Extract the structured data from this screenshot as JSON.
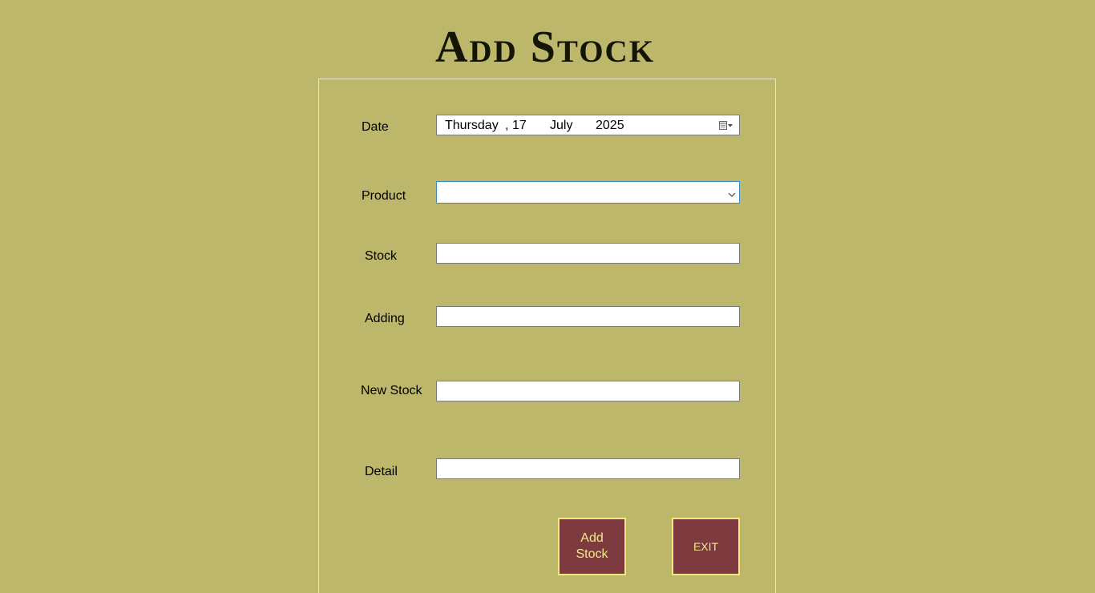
{
  "page": {
    "title": "Add Stock"
  },
  "form": {
    "date": {
      "label": "Date",
      "weekday": "Thursday",
      "separator": ",",
      "day": "17",
      "month": "July",
      "year": "2025",
      "icon": "calendar-dropdown-icon"
    },
    "product": {
      "label": "Product",
      "value": "",
      "icon": "chevron-down-icon"
    },
    "stock": {
      "label": "Stock",
      "value": ""
    },
    "adding": {
      "label": "Adding",
      "value": ""
    },
    "new_stock": {
      "label": "New Stock",
      "value": ""
    },
    "detail": {
      "label": "Detail",
      "value": ""
    }
  },
  "buttons": {
    "add_stock": "Add Stock",
    "exit": "EXIT"
  },
  "colors": {
    "background": "#bdb76b",
    "button_bg": "#7d3b3f",
    "button_border": "#f2e97a",
    "button_text": "#f5e88c"
  }
}
